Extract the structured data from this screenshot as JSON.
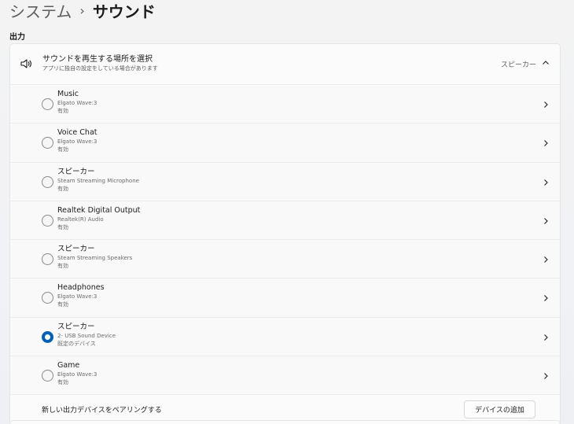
{
  "breadcrumb": {
    "parent": "システム",
    "separator": "›",
    "current": "サウンド"
  },
  "section": {
    "label": "出力"
  },
  "output_selector": {
    "icon": "speaker-icon",
    "title": "サウンドを再生する場所を選択",
    "subtitle": "アプリに独自の設定をしている場合があります",
    "current_value": "スピーカー",
    "expanded": true
  },
  "devices": [
    {
      "name": "Music",
      "description": "Elgato Wave:3",
      "status": "有効",
      "selected": false
    },
    {
      "name": "Voice Chat",
      "description": "Elgato Wave:3",
      "status": "有効",
      "selected": false
    },
    {
      "name": "スピーカー",
      "description": "Steam Streaming Microphone",
      "status": "有効",
      "selected": false
    },
    {
      "name": "Realtek Digital Output",
      "description": "Realtek(R) Audio",
      "status": "有効",
      "selected": false
    },
    {
      "name": "スピーカー",
      "description": "Steam Streaming Speakers",
      "status": "有効",
      "selected": false
    },
    {
      "name": "Headphones",
      "description": "Elgato Wave:3",
      "status": "有効",
      "selected": false
    },
    {
      "name": "スピーカー",
      "description": "2- USB Sound Device",
      "status": "既定のデバイス",
      "selected": true
    },
    {
      "name": "Game",
      "description": "Elgato Wave:3",
      "status": "有効",
      "selected": false
    }
  ],
  "pairing": {
    "label": "新しい出力デバイスをペアリングする",
    "button_label": "デバイスの追加"
  },
  "colors": {
    "accent": "#005fb8"
  }
}
